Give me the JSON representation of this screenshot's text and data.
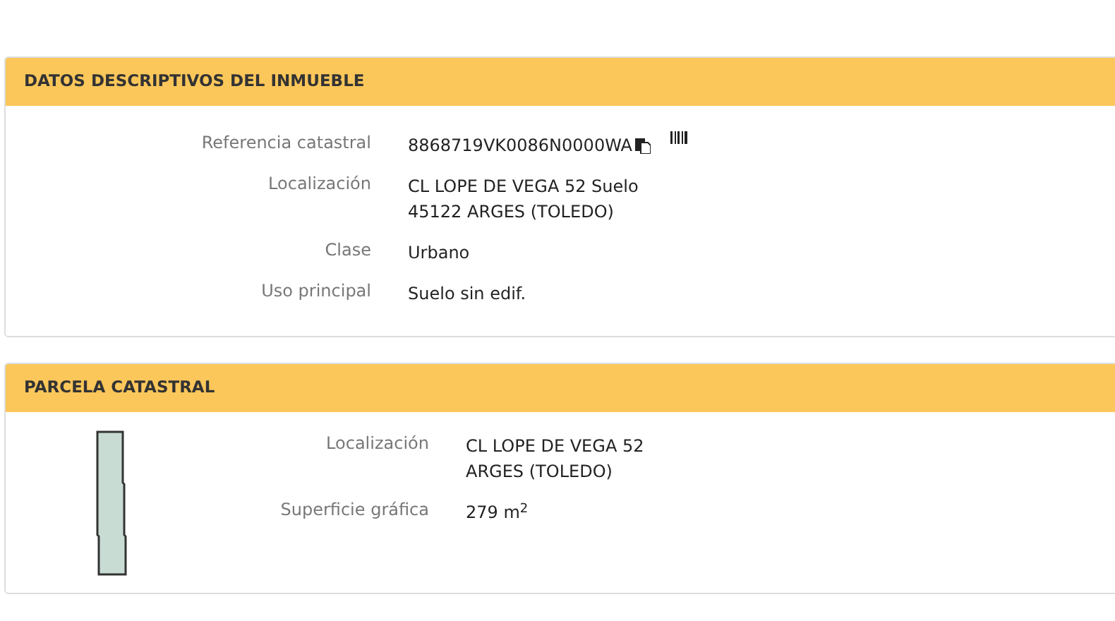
{
  "panels": [
    {
      "title": "DATOS DESCRIPTIVOS DEL INMUEBLE",
      "kind": "details",
      "rows": [
        {
          "label": "Referencia catastral",
          "lines": [
            "8868719VK0086N0000WA"
          ],
          "copy": true,
          "barcode": true
        },
        {
          "label": "Localización",
          "lines": [
            "CL LOPE DE VEGA 52 Suelo",
            "45122 ARGES (TOLEDO)"
          ]
        },
        {
          "label": "Clase",
          "lines": [
            "Urbano"
          ]
        },
        {
          "label": "Uso principal",
          "lines": [
            "Suelo sin edif."
          ]
        }
      ]
    },
    {
      "title": "PARCELA CATASTRAL",
      "kind": "parcel",
      "rows": [
        {
          "label": "Localización",
          "lines": [
            "CL LOPE DE VEGA 52",
            "ARGES (TOLEDO)"
          ]
        },
        {
          "label": "Superficie gráfica",
          "lines": [
            "279 m$^{2}$"
          ]
        }
      ]
    }
  ]
}
